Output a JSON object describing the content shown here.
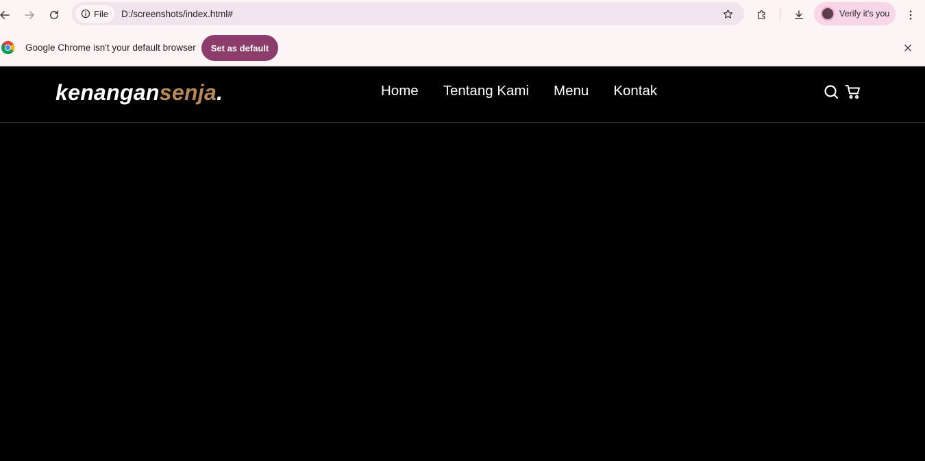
{
  "browser": {
    "url_chip_label": "File",
    "url": "D:/screenshots/index.html#",
    "profile_label": "Verify it's you",
    "icons": {
      "back": "back-arrow-icon",
      "forward": "forward-arrow-icon",
      "reload": "reload-icon",
      "info": "info-icon",
      "bookmark": "star-icon",
      "extensions": "puzzle-icon",
      "downloads": "download-icon",
      "menu": "kebab-menu-icon"
    }
  },
  "infobar": {
    "message": "Google Chrome isn't your default browser",
    "button_label": "Set as default",
    "button_color": "#8c3d6b"
  },
  "site": {
    "logo_main": "kenangan",
    "logo_accent": "senja",
    "logo_suffix": ".",
    "accent_color": "#b6895b",
    "nav": [
      "Home",
      "Tentang Kami",
      "Menu",
      "Kontak"
    ],
    "icons": [
      "search-icon",
      "cart-icon"
    ]
  }
}
